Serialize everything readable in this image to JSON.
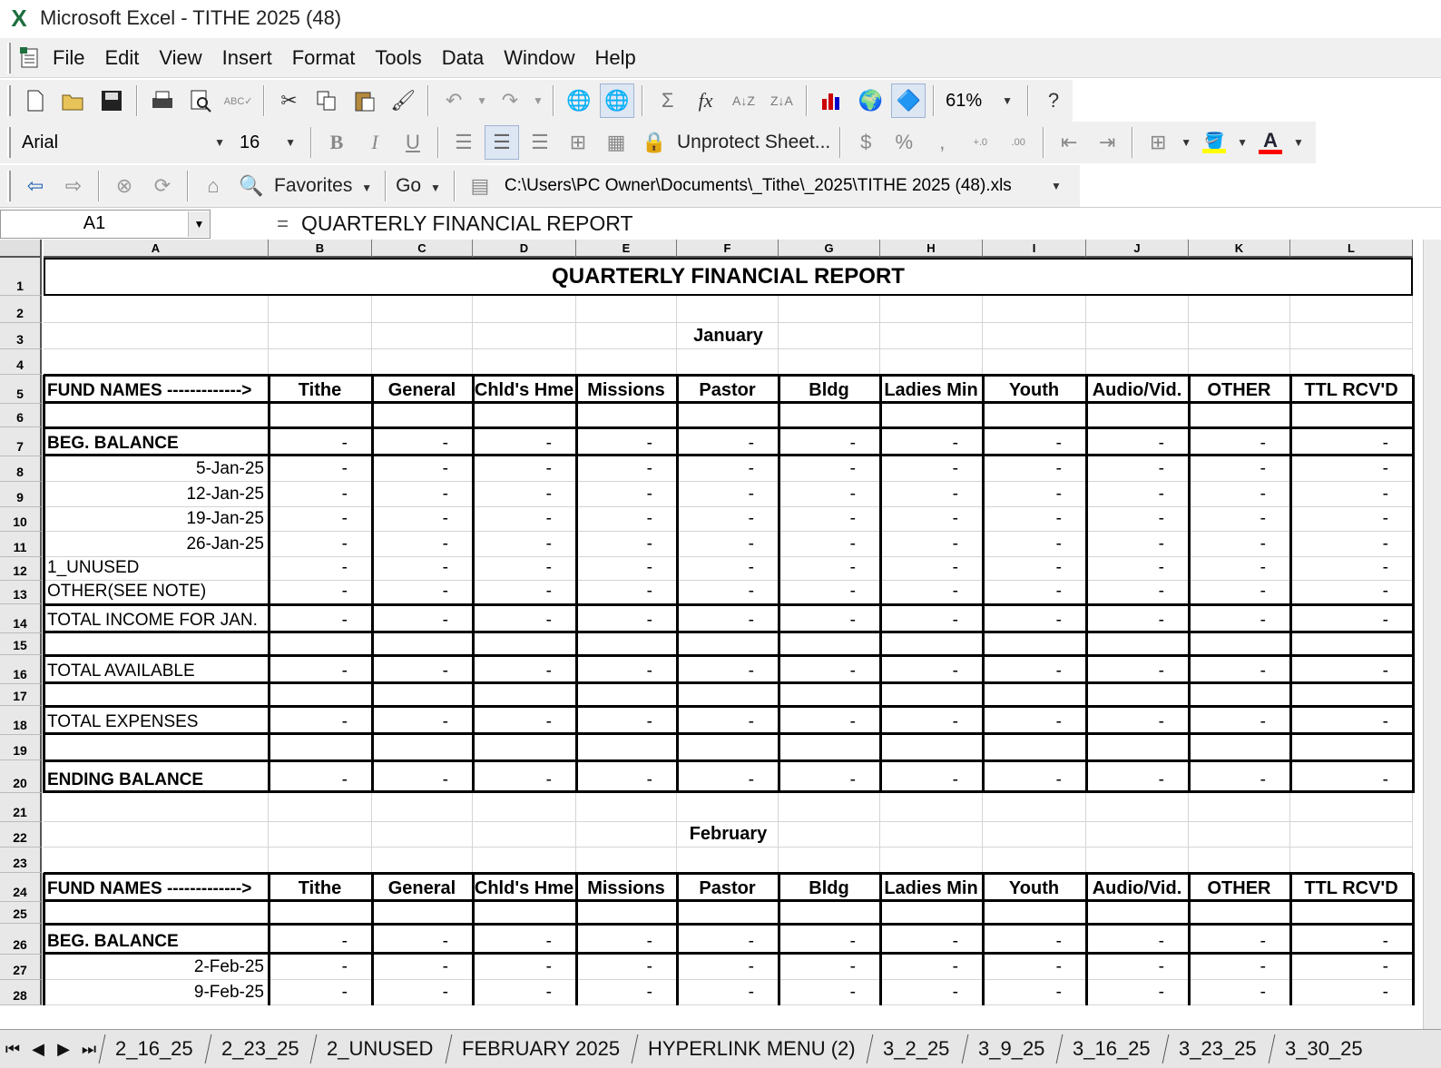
{
  "window": {
    "title": "Microsoft Excel - TITHE 2025 (48)"
  },
  "menu": [
    "File",
    "Edit",
    "View",
    "Insert",
    "Format",
    "Tools",
    "Data",
    "Window",
    "Help"
  ],
  "toolbar": {
    "zoom": "61%",
    "font": "Arial",
    "font_size": "16",
    "unprotect_label": "Unprotect Sheet...",
    "favorites_label": "Favorites",
    "go_label": "Go",
    "path": "C:\\Users\\PC Owner\\Documents\\_Tithe\\_2025\\TITHE 2025 (48).xls",
    "accent_fill": "#ffff00",
    "accent_font": "#ff0000"
  },
  "formula_bar": {
    "name_box": "A1",
    "eq": "=",
    "content": "QUARTERLY FINANCIAL REPORT"
  },
  "columns": [
    "A",
    "B",
    "C",
    "D",
    "E",
    "F",
    "G",
    "H",
    "I",
    "J",
    "K",
    "L"
  ],
  "rows": [
    "1",
    "2",
    "3",
    "4",
    "5",
    "6",
    "7",
    "8",
    "9",
    "10",
    "11",
    "12",
    "13",
    "14",
    "15",
    "16",
    "17",
    "18",
    "19",
    "20",
    "21",
    "22",
    "23",
    "24",
    "25",
    "26",
    "27",
    "28"
  ],
  "report": {
    "title": "QUARTERLY FINANCIAL REPORT",
    "fund_header": [
      "FUND NAMES ------------->",
      "Tithe",
      "General",
      "Chld's Hme",
      "Missions",
      "Pastor",
      "Bldg",
      "Ladies Min",
      "Youth",
      "Audio/Vid.",
      "OTHER",
      "TTL RCV'D"
    ],
    "dash": "-",
    "january": {
      "month": "January",
      "beg": "BEG. BALANCE",
      "dates": [
        "5-Jan-25",
        "12-Jan-25",
        "19-Jan-25",
        "26-Jan-25"
      ],
      "unused": "1_UNUSED",
      "other": "OTHER(SEE NOTE)",
      "total_income": "TOTAL INCOME FOR JAN.",
      "total_available": "TOTAL AVAILABLE",
      "total_expenses": "TOTAL EXPENSES",
      "ending": "ENDING BALANCE"
    },
    "february": {
      "month": "February",
      "beg": "BEG. BALANCE",
      "dates": [
        "2-Feb-25",
        "9-Feb-25"
      ]
    }
  },
  "sheet_tabs": [
    "2_16_25",
    "2_23_25",
    "2_UNUSED",
    "FEBRUARY 2025",
    "HYPERLINK MENU (2)",
    "3_2_25",
    "3_9_25",
    "3_16_25",
    "3_23_25",
    "3_30_25"
  ]
}
